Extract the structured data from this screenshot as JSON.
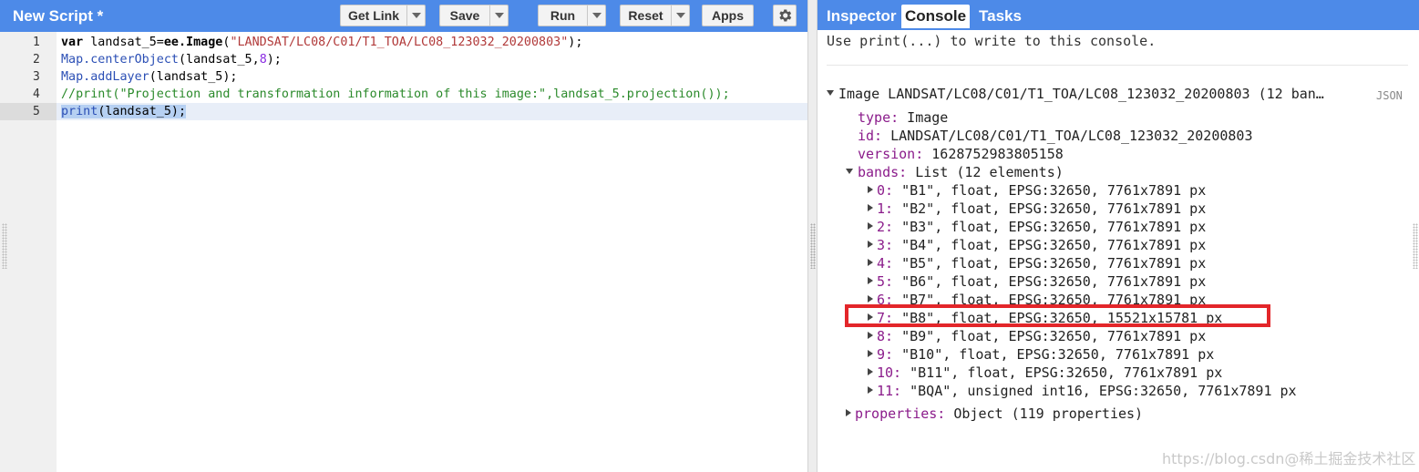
{
  "editor": {
    "title": "New Script *",
    "buttons": {
      "get_link": "Get Link",
      "save": "Save",
      "run": "Run",
      "reset": "Reset",
      "apps": "Apps"
    },
    "line_numbers": [
      "1",
      "2",
      "3",
      "4",
      "5"
    ],
    "active_line": 5,
    "code": {
      "l1_kw": "var",
      "l1_a": " landsat_5=",
      "l1_b": "ee.Image",
      "l1_c": "(",
      "l1_str": "\"LANDSAT/LC08/C01/T1_TOA/LC08_123032_20200803\"",
      "l1_end": ");",
      "l2_fn": "Map.centerObject",
      "l2_a": "(landsat_5,",
      "l2_num": "8",
      "l2_end": ");",
      "l3_fn": "Map.addLayer",
      "l3_a": "(landsat_5);",
      "l4_cmt": "//print(\"Projection and transformation information of this image:\",landsat_5.projection());",
      "l5_fn": "print",
      "l5_a": "(landsat_5);"
    }
  },
  "console": {
    "tabs": {
      "inspector": "Inspector",
      "console": "Console",
      "tasks": "Tasks"
    },
    "active_tab": "Console",
    "hint": "Use print(...) to write to this console.",
    "json_label": "JSON",
    "image_header": "Image LANDSAT/LC08/C01/T1_TOA/LC08_123032_20200803 (12 ban…",
    "type_key": "type:",
    "type_val": " Image",
    "id_key": "id:",
    "id_val": " LANDSAT/LC08/C01/T1_TOA/LC08_123032_20200803",
    "version_key": "version:",
    "version_val": " 1628752983805158",
    "bands_key": "bands:",
    "bands_val": " List (12 elements)",
    "bands": [
      {
        "idx": "0:",
        "desc": " \"B1\", float, EPSG:32650, 7761x7891 px"
      },
      {
        "idx": "1:",
        "desc": " \"B2\", float, EPSG:32650, 7761x7891 px"
      },
      {
        "idx": "2:",
        "desc": " \"B3\", float, EPSG:32650, 7761x7891 px"
      },
      {
        "idx": "3:",
        "desc": " \"B4\", float, EPSG:32650, 7761x7891 px"
      },
      {
        "idx": "4:",
        "desc": " \"B5\", float, EPSG:32650, 7761x7891 px"
      },
      {
        "idx": "5:",
        "desc": " \"B6\", float, EPSG:32650, 7761x7891 px"
      },
      {
        "idx": "6:",
        "desc": " \"B7\", float, EPSG:32650, 7761x7891 px"
      },
      {
        "idx": "7:",
        "desc": " \"B8\", float, EPSG:32650, 15521x15781 px"
      },
      {
        "idx": "8:",
        "desc": " \"B9\", float, EPSG:32650, 7761x7891 px"
      },
      {
        "idx": "9:",
        "desc": " \"B10\", float, EPSG:32650, 7761x7891 px"
      },
      {
        "idx": "10:",
        "desc": " \"B11\", float, EPSG:32650, 7761x7891 px"
      },
      {
        "idx": "11:",
        "desc": " \"BQA\", unsigned int16, EPSG:32650, 7761x7891 px"
      }
    ],
    "properties_key": "properties:",
    "properties_val": " Object (119 properties)",
    "highlight_color": "#e3262a"
  },
  "watermark": "https://blog.csdn@稀土掘金技术社区",
  "colors": {
    "toolbar_blue": "#4d8ae8",
    "key_purple": "#8b1c8b",
    "string_red": "#b13a3a",
    "comment_green": "#2b8a2b",
    "function_blue": "#2b4fb5"
  }
}
